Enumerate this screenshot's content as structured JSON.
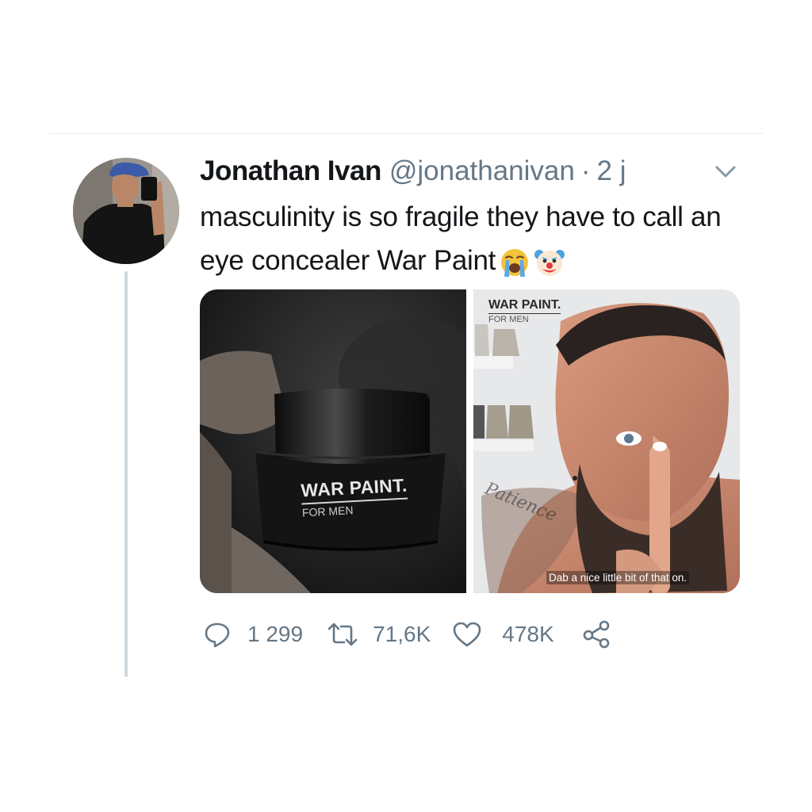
{
  "tweet": {
    "display_name": "Jonathan Ivan",
    "handle": "@jonathanivan",
    "separator": "·",
    "time": "2 j",
    "text": "masculinity is so fragile they have to call an eye concealer War Paint",
    "emojis": [
      "loudly-crying-face",
      "clown-face"
    ]
  },
  "media": {
    "left": {
      "product_title": "WAR PAINT.",
      "product_subtitle": "FOR MEN"
    },
    "right": {
      "product_title": "WAR PAINT.",
      "product_subtitle": "FOR MEN",
      "tattoo_text": "Patience",
      "caption": "Dab a nice little bit of that on."
    }
  },
  "actions": {
    "replies": "1 299",
    "retweets": "71,6K",
    "likes": "478K"
  },
  "colors": {
    "text": "#14171a",
    "secondary": "#657786",
    "thread_line": "#cfd9de",
    "divider": "#e6ecf0"
  }
}
